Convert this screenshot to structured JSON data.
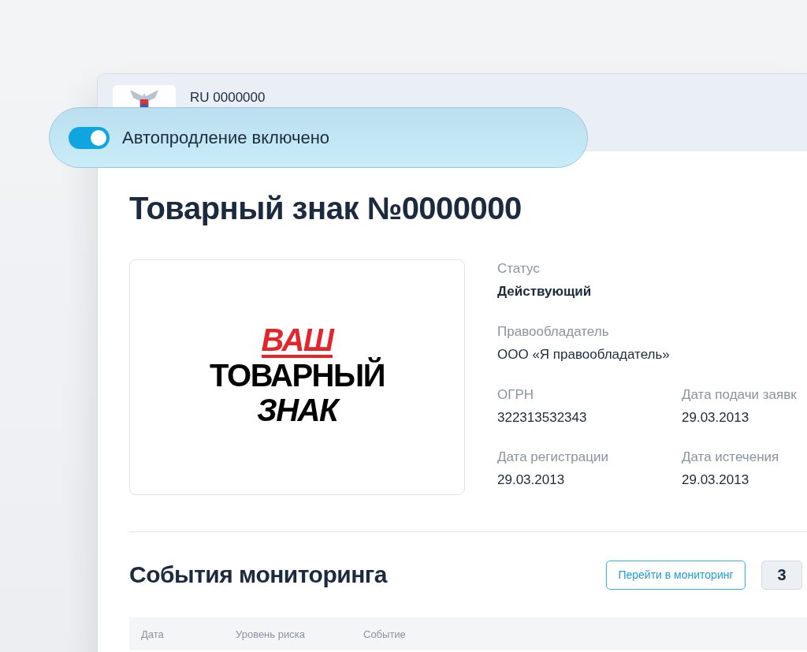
{
  "header": {
    "number": "RU 0000000"
  },
  "banner": {
    "on": true,
    "label": "Автопродление включено"
  },
  "title": "Товарный знак №0000000",
  "mark_image": {
    "lines": [
      {
        "text": "ВАШ",
        "kind": "accent"
      },
      {
        "text": "ТОВАРНЫЙ",
        "kind": "plain"
      },
      {
        "text": "ЗНАК",
        "kind": "italic"
      }
    ]
  },
  "fields": [
    {
      "label": "Статус",
      "value": "Действующий",
      "kind": "status"
    },
    {
      "label": "Правообладатель",
      "value": "ООО «Я правообладатель»",
      "kind": "wide"
    },
    {
      "label": "ОГРН",
      "value": "322313532343",
      "kind": "half"
    },
    {
      "label": "Дата подачи заявк",
      "value": "29.03.2013",
      "kind": "half"
    },
    {
      "label": "Дата регистрации",
      "value": "29.03.2013",
      "kind": "half"
    },
    {
      "label": "Дата истечения",
      "value": "29.03.2013",
      "kind": "half"
    }
  ],
  "events": {
    "title": "События мониторинга",
    "button": "Перейти в мониторинг",
    "count": "3",
    "columns": [
      "Дата",
      "Уровень риска",
      "Событие"
    ]
  }
}
